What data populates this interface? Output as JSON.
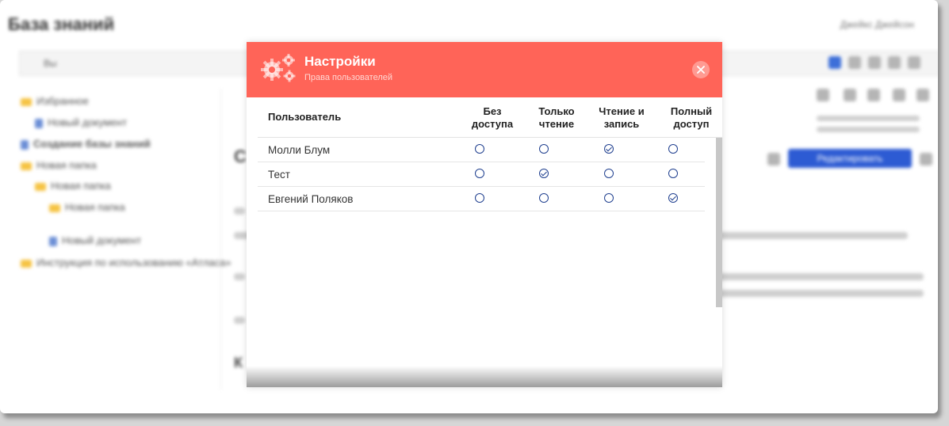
{
  "background": {
    "app_title": "База знаний",
    "user": "Джейкс Джейсон",
    "toolbar_item": "Вы",
    "tree": [
      {
        "label": "Избранное",
        "icon": "folder-icon"
      },
      {
        "label": "Новый документ",
        "icon": "document-icon"
      },
      {
        "label": "Создание базы знаний",
        "icon": "document-icon"
      },
      {
        "label": "Новая папка",
        "icon": "folder-icon"
      },
      {
        "label": "Новая папка",
        "icon": "folder-icon"
      },
      {
        "label": "Новая папка",
        "icon": "folder-icon"
      },
      {
        "label": "Новый документ",
        "icon": "document-icon"
      },
      {
        "label": "Инструкция по использованию «Атласа»",
        "icon": "folder-icon"
      }
    ],
    "edit_button": "Редактировать"
  },
  "dialog": {
    "title": "Настройки",
    "subtitle": "Права пользователей",
    "header_icon": "gears-icon",
    "close_icon": "close-icon",
    "accent_color": "#ff6458",
    "radio_color": "#1f3f8f",
    "columns": {
      "user": "Пользователь",
      "access": [
        "Без доступа",
        "Только чтение",
        "Чтение и запись",
        "Полный доступ"
      ]
    },
    "rows": [
      {
        "user": "Молли Блум",
        "selected": 2
      },
      {
        "user": "Тест",
        "selected": 1
      },
      {
        "user": "Евгений Поляков",
        "selected": 3
      }
    ]
  }
}
